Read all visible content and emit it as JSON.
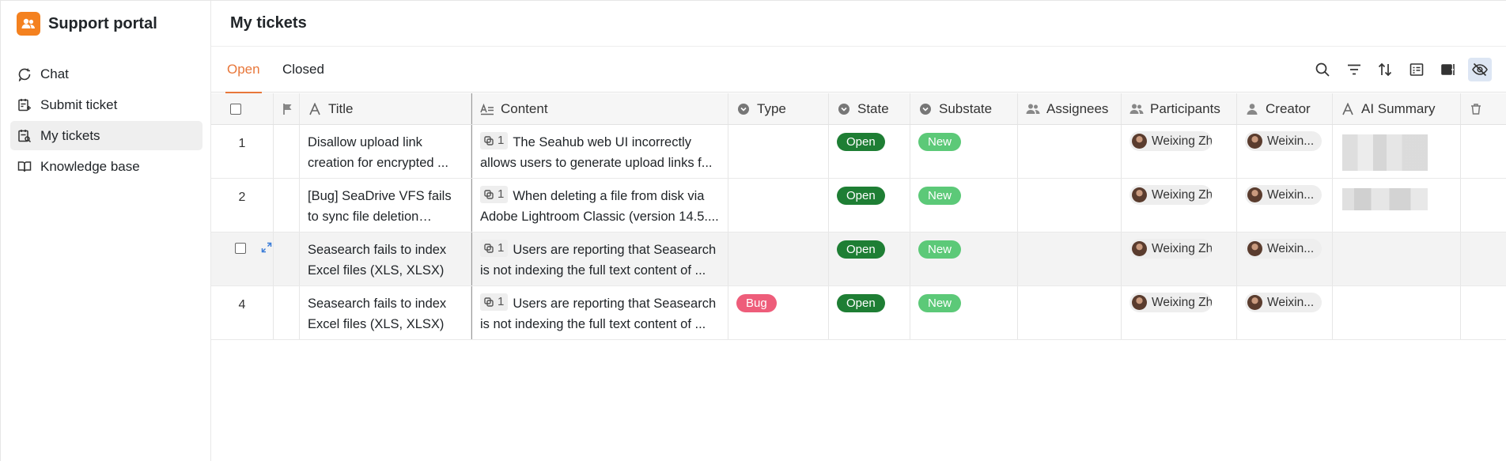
{
  "sidebar": {
    "app_title": "Support portal",
    "items": [
      {
        "label": "Chat",
        "icon": "chat-icon"
      },
      {
        "label": "Submit ticket",
        "icon": "submit-ticket-icon"
      },
      {
        "label": "My tickets",
        "icon": "tickets-icon",
        "active": true
      },
      {
        "label": "Knowledge base",
        "icon": "book-icon"
      }
    ]
  },
  "main": {
    "title": "My tickets",
    "tabs": [
      {
        "label": "Open",
        "active": true
      },
      {
        "label": "Closed",
        "active": false
      }
    ],
    "tools": [
      "search-icon",
      "filter-icon",
      "sort-icon",
      "group-icon",
      "row-height-icon",
      "hide-columns-icon"
    ]
  },
  "table": {
    "columns": {
      "title": "Title",
      "content": "Content",
      "type": "Type",
      "state": "State",
      "substate": "Substate",
      "assignees": "Assignees",
      "participants": "Participants",
      "creator": "Creator",
      "ai_summary": "AI Summary"
    },
    "rows": [
      {
        "num": "1",
        "title": "Disallow upload link creation for encrypted ...",
        "content_count": "1",
        "content": "The Seahub web UI incorrectly allows users to generate upload links f...",
        "type": "",
        "state": "Open",
        "substate": "New",
        "participant": "Weixing Zh...",
        "creator": "Weixin..."
      },
      {
        "num": "2",
        "title": "[Bug] SeaDrive VFS fails to sync file deletion initiate...",
        "content_count": "1",
        "content": "When deleting a file from disk via Adobe Lightroom Classic (version 14.5....",
        "type": "",
        "state": "Open",
        "substate": "New",
        "participant": "Weixing Zh...",
        "creator": "Weixin..."
      },
      {
        "num": "",
        "title": "Seasearch fails to index Excel files (XLS, XLSX)",
        "content_count": "1",
        "content": "Users are reporting that Seasearch is not indexing the full text content of ...",
        "type": "",
        "state": "Open",
        "substate": "New",
        "participant": "Weixing Zh...",
        "creator": "Weixin..."
      },
      {
        "num": "4",
        "title": "Seasearch fails to index Excel files (XLS, XLSX)",
        "content_count": "1",
        "content": "Users are reporting that Seasearch is not indexing the full text content of ...",
        "type": "Bug",
        "state": "Open",
        "substate": "New",
        "participant": "Weixing Zh...",
        "creator": "Weixin..."
      }
    ]
  },
  "colors": {
    "accent": "#e8773a",
    "brand": "#f4811f",
    "open": "#1e7e34",
    "new": "#5cc978",
    "bug": "#ee5d7a"
  }
}
